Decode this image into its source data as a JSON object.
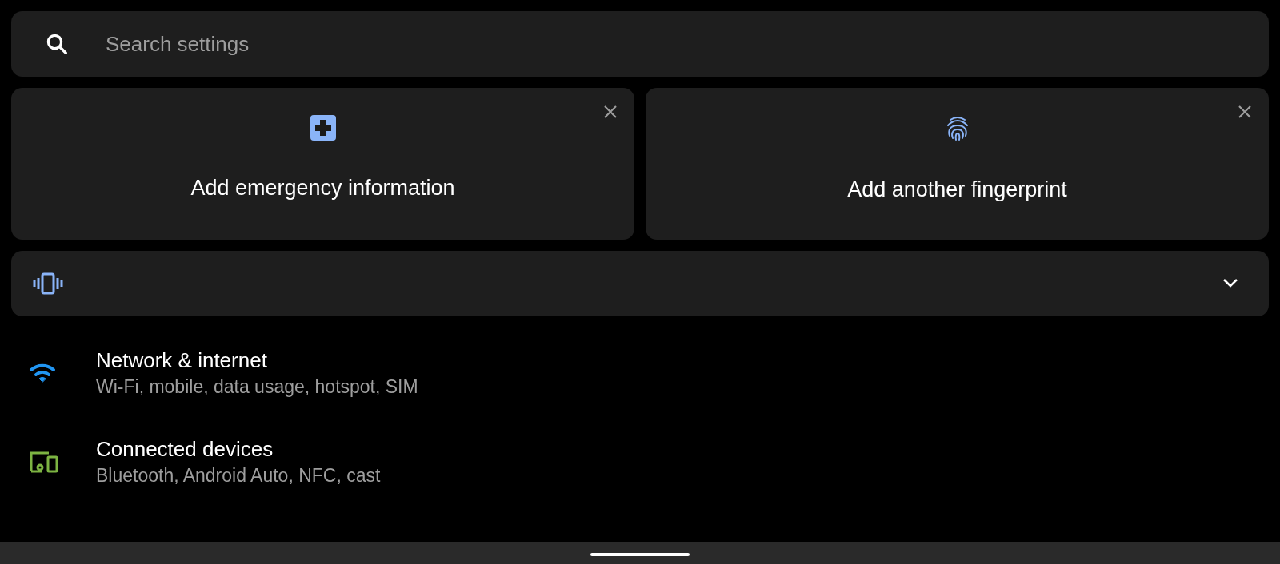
{
  "search": {
    "placeholder": "Search settings"
  },
  "suggestions": [
    {
      "kind": "medical",
      "title": "Add emergency information"
    },
    {
      "kind": "fingerprint",
      "title": "Add another fingerprint"
    }
  ],
  "sound_mode": {
    "kind": "vibrate",
    "expanded": false
  },
  "settings_items": [
    {
      "kind": "wifi",
      "color": "#2196f3",
      "title": "Network & internet",
      "summary": "Wi-Fi, mobile, data usage, hotspot, SIM"
    },
    {
      "kind": "devices",
      "color": "#7cb342",
      "title": "Connected devices",
      "summary": "Bluetooth, Android Auto, NFC, cast"
    }
  ]
}
